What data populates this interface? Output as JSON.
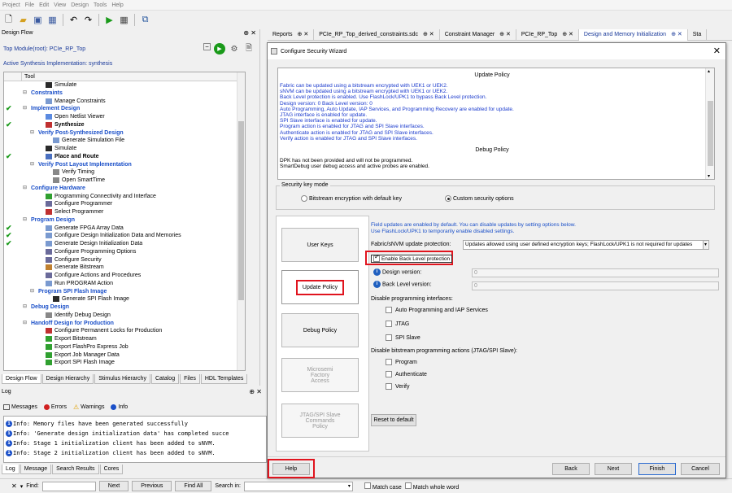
{
  "menu": [
    "Project",
    "File",
    "Edit",
    "View",
    "Design",
    "Tools",
    "Help"
  ],
  "design_flow": {
    "title": "Design Flow",
    "pin": "⊕ ✕",
    "top_module": "Top Module(root): PCIe_RP_Top",
    "impl": "Active Synthesis Implementation: synthesis",
    "column": "Tool",
    "rows": [
      {
        "label": "Simulate",
        "indent": 3,
        "check": false,
        "cat": false,
        "bold": false,
        "icon": "#2a2a2a"
      },
      {
        "label": "Constraints",
        "indent": 1,
        "check": false,
        "cat": true,
        "bold": false,
        "icon": ""
      },
      {
        "label": "Manage Constraints",
        "indent": 3,
        "check": false,
        "cat": false,
        "bold": false,
        "icon": "#7a9ad0"
      },
      {
        "label": "Implement Design",
        "indent": 1,
        "check": true,
        "cat": true,
        "bold": false,
        "icon": ""
      },
      {
        "label": "Open Netlist Viewer",
        "indent": 3,
        "check": false,
        "cat": false,
        "bold": false,
        "icon": "#5a8ae0"
      },
      {
        "label": "Synthesize",
        "indent": 3,
        "check": true,
        "cat": false,
        "bold": true,
        "icon": "#c03030"
      },
      {
        "label": "Verify Post-Synthesized Design",
        "indent": 2,
        "check": false,
        "cat": true,
        "bold": false,
        "icon": ""
      },
      {
        "label": "Generate Simulation File",
        "indent": 4,
        "check": false,
        "cat": false,
        "bold": false,
        "icon": "#7a9ad0"
      },
      {
        "label": "Simulate",
        "indent": 3,
        "check": false,
        "cat": false,
        "bold": false,
        "icon": "#2a2a2a"
      },
      {
        "label": "Place and Route",
        "indent": 3,
        "check": true,
        "cat": false,
        "bold": true,
        "icon": "#4a70c0"
      },
      {
        "label": "Verify Post Layout Implementation",
        "indent": 2,
        "check": false,
        "cat": true,
        "bold": false,
        "icon": ""
      },
      {
        "label": "Verify Timing",
        "indent": 4,
        "check": false,
        "cat": false,
        "bold": false,
        "icon": "#888"
      },
      {
        "label": "Open SmartTime",
        "indent": 4,
        "check": false,
        "cat": false,
        "bold": false,
        "icon": "#888"
      },
      {
        "label": "Configure Hardware",
        "indent": 1,
        "check": false,
        "cat": true,
        "bold": false,
        "icon": ""
      },
      {
        "label": "Programming Connectivity and Interface",
        "indent": 3,
        "check": false,
        "cat": false,
        "bold": false,
        "icon": "#30a030"
      },
      {
        "label": "Configure Programmer",
        "indent": 3,
        "check": false,
        "cat": false,
        "bold": false,
        "icon": "#6a6a9a"
      },
      {
        "label": "Select Programmer",
        "indent": 3,
        "check": false,
        "cat": false,
        "bold": false,
        "icon": "#c03030"
      },
      {
        "label": "Program Design",
        "indent": 1,
        "check": false,
        "cat": true,
        "bold": false,
        "icon": ""
      },
      {
        "label": "Generate FPGA Array Data",
        "indent": 3,
        "check": true,
        "cat": false,
        "bold": false,
        "icon": "#7a9ad0"
      },
      {
        "label": "Configure Design Initialization Data and Memories",
        "indent": 3,
        "check": true,
        "cat": false,
        "bold": false,
        "icon": "#7a9ad0"
      },
      {
        "label": "Generate Design Initialization Data",
        "indent": 3,
        "check": true,
        "cat": false,
        "bold": false,
        "icon": "#7a9ad0"
      },
      {
        "label": "Configure Programming Options",
        "indent": 3,
        "check": false,
        "cat": false,
        "bold": false,
        "icon": "#6a6a9a"
      },
      {
        "label": "Configure Security",
        "indent": 3,
        "check": false,
        "cat": false,
        "bold": false,
        "icon": "#6a6a9a"
      },
      {
        "label": "Generate Bitstream",
        "indent": 3,
        "check": false,
        "cat": false,
        "bold": false,
        "icon": "#c08030"
      },
      {
        "label": "Configure Actions and Procedures",
        "indent": 3,
        "check": false,
        "cat": false,
        "bold": false,
        "icon": "#6a6a9a"
      },
      {
        "label": "Run PROGRAM Action",
        "indent": 3,
        "check": false,
        "cat": false,
        "bold": false,
        "icon": "#7a9ad0"
      },
      {
        "label": "Program SPI Flash Image",
        "indent": 2,
        "check": false,
        "cat": true,
        "bold": false,
        "icon": ""
      },
      {
        "label": "Generate SPI Flash Image",
        "indent": 4,
        "check": false,
        "cat": false,
        "bold": false,
        "icon": "#2a2a2a"
      },
      {
        "label": "Debug Design",
        "indent": 1,
        "check": false,
        "cat": true,
        "bold": false,
        "icon": ""
      },
      {
        "label": "Identify Debug Design",
        "indent": 3,
        "check": false,
        "cat": false,
        "bold": false,
        "icon": "#888"
      },
      {
        "label": "Handoff Design for Production",
        "indent": 1,
        "check": false,
        "cat": true,
        "bold": false,
        "icon": ""
      },
      {
        "label": "Configure Permanent Locks for Production",
        "indent": 3,
        "check": false,
        "cat": false,
        "bold": false,
        "icon": "#c03030"
      },
      {
        "label": "Export Bitstream",
        "indent": 3,
        "check": false,
        "cat": false,
        "bold": false,
        "icon": "#30a030"
      },
      {
        "label": "Export FlashPro Express Job",
        "indent": 3,
        "check": false,
        "cat": false,
        "bold": false,
        "icon": "#30a030"
      },
      {
        "label": "Export Job Manager Data",
        "indent": 3,
        "check": false,
        "cat": false,
        "bold": false,
        "icon": "#30a030"
      },
      {
        "label": "Export SPI Flash Image",
        "indent": 3,
        "check": false,
        "cat": false,
        "bold": false,
        "icon": "#30a030"
      }
    ],
    "bottom_tabs": [
      "Design Flow",
      "Design Hierarchy",
      "Stimulus Hierarchy",
      "Catalog",
      "Files",
      "HDL Templates"
    ]
  },
  "log": {
    "title": "Log",
    "filters": {
      "messages": "Messages",
      "errors": "Errors",
      "warnings": "Warnings",
      "info": "Info"
    },
    "lines": [
      "Info: Memory files have been generated successfully",
      "Info: 'Generate design initialization data' has completed succe",
      "Info: Stage 1 initialization client has been added to sNVM.",
      "Info: Stage 2 initialization client has been added to sNVM."
    ],
    "tabs": [
      "Log",
      "Message",
      "Search Results",
      "Cores"
    ]
  },
  "find": {
    "find_label": "Find:",
    "next": "Next",
    "previous": "Previous",
    "find_all": "Find All",
    "search_in": "Search in:",
    "match_case": "Match case",
    "match_whole": "Match whole word"
  },
  "doc_tabs": [
    {
      "label": "Reports",
      "active": false
    },
    {
      "label": "PCIe_RP_Top_derived_constraints.sdc",
      "active": false
    },
    {
      "label": "Constraint Manager",
      "active": false
    },
    {
      "label": "PCIe_RP_Top",
      "active": false
    },
    {
      "label": "Design and Memory Initialization",
      "active": true
    },
    {
      "label": "Sta",
      "active": false
    }
  ],
  "dialog": {
    "title": "Configure Security Wizard",
    "policy": {
      "update_heading": "Update Policy",
      "update_lines": [
        "Fabric can be updated using a bitstream encrypted with UEK1 or UEK2.",
        "sNVM can be updated using a bitstream encrypted with UEK1 or UEK2.",
        "Back Level protection is enabled. Use FlashLock/UPK1 to bypass Back Level protection.",
        "Design version: 0    Back Level version: 0",
        "Auto Programming, Auto Update, IAP Services, and Programming Recovery are enabled for update.",
        "JTAG interface is enabled for update.",
        "SPI Slave interface is enabled for update.",
        "Program action is enabled for JTAG and SPI Slave interfaces.",
        "Authenticate action is enabled for JTAG and SPI Slave interfaces.",
        "Verify action is enabled for JTAG and SPI Slave interfaces."
      ],
      "debug_heading": "Debug Policy",
      "debug_lines": [
        "DPK has not been provided and will not be programmed.",
        "SmartDebug user debug access and active probes are enabled."
      ]
    },
    "key_mode": {
      "legend": "Security key mode",
      "opt_default": "Bitstream encryption with default key",
      "opt_custom": "Custom security options"
    },
    "steps": [
      {
        "label": "User Keys",
        "state": "normal"
      },
      {
        "label": "Update Policy",
        "state": "active"
      },
      {
        "label": "Debug Policy",
        "state": "normal"
      },
      {
        "label": "Microsemi\nFactory\nAccess",
        "state": "disabled"
      },
      {
        "label": "JTAG/SPI Slave\nCommands\nPolicy",
        "state": "disabled"
      }
    ],
    "hint1": "Field updates are enabled by default. You can disable updates by setting options below.",
    "hint2": "Use FlashLock/UPK1 to temporarily enable disabled settings.",
    "update_protection_label": "Fabric/sNVM update protection:",
    "update_protection_value": "Updates allowed using user defined encryption keys; FlashLock/UPK1 is not required for updates",
    "back_level_checkbox": "Enable Back Level protection",
    "design_version_label": "Design version:",
    "design_version_value": "0",
    "back_level_label": "Back Level version:",
    "back_level_value": "0",
    "disable_interfaces_label": "Disable programming interfaces:",
    "interfaces": [
      "Auto Programming and IAP Services",
      "JTAG",
      "SPI Slave"
    ],
    "disable_actions_label": "Disable bitstream programming actions (JTAG/SPI Slave):",
    "actions": [
      "Program",
      "Authenticate",
      "Verify"
    ],
    "reset_button": "Reset to default",
    "help": "Help",
    "back": "Back",
    "next": "Next",
    "finish": "Finish",
    "cancel": "Cancel"
  },
  "colors": {
    "accent_blue": "#1a4fc8",
    "highlight_red": "#e0141e",
    "check_green": "#1a9a1a"
  }
}
